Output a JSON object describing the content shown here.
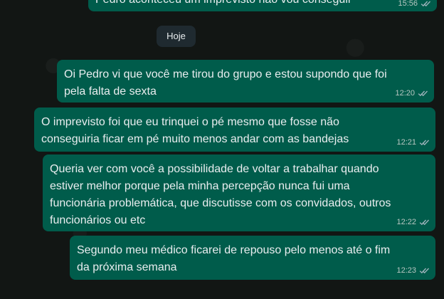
{
  "chat": {
    "date_separator": "Hoje",
    "messages": [
      {
        "text": "Pedro aconteceu um imprevisto não vou conseguir",
        "time": "15:56"
      },
      {
        "text": "Oi Pedro vi que você me tirou do grupo e estou supondo que foi\npela falta de sexta",
        "time": "12:20"
      },
      {
        "text": "O imprevisto foi que eu trinquei o pé mesmo que fosse não\nconseguiria ficar em pé muito menos andar com as bandejas",
        "time": "12:21"
      },
      {
        "text": "Queria ver com você a possibilidade de voltar a trabalhar quando\nestiver melhor porque pela minha percepção nunca fui uma\nfuncionária problemática, que discutisse com os convidados, outros\nfuncionários ou etc",
        "time": "12:22"
      },
      {
        "text": "Segundo meu médico ficarei de repouso pelo menos até o fim\nda próxima semana",
        "time": "12:23"
      }
    ]
  },
  "icons": {
    "read_receipt": "double-check-icon"
  }
}
